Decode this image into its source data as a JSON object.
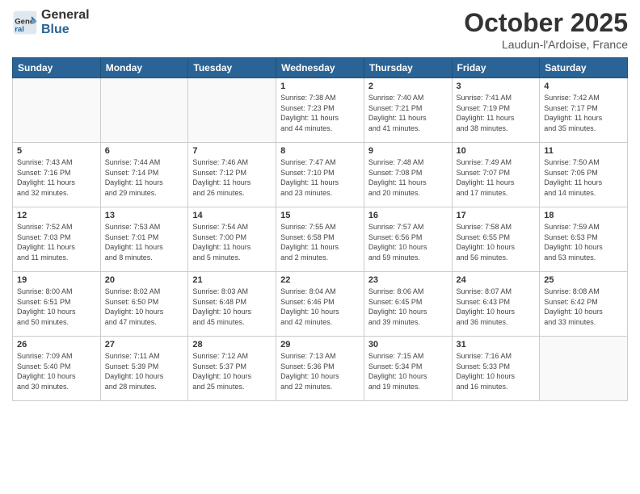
{
  "header": {
    "logo_general": "General",
    "logo_blue": "Blue",
    "month_title": "October 2025",
    "location": "Laudun-l'Ardoise, France"
  },
  "days_of_week": [
    "Sunday",
    "Monday",
    "Tuesday",
    "Wednesday",
    "Thursday",
    "Friday",
    "Saturday"
  ],
  "weeks": [
    [
      {
        "day": "",
        "info": ""
      },
      {
        "day": "",
        "info": ""
      },
      {
        "day": "",
        "info": ""
      },
      {
        "day": "1",
        "info": "Sunrise: 7:38 AM\nSunset: 7:23 PM\nDaylight: 11 hours\nand 44 minutes."
      },
      {
        "day": "2",
        "info": "Sunrise: 7:40 AM\nSunset: 7:21 PM\nDaylight: 11 hours\nand 41 minutes."
      },
      {
        "day": "3",
        "info": "Sunrise: 7:41 AM\nSunset: 7:19 PM\nDaylight: 11 hours\nand 38 minutes."
      },
      {
        "day": "4",
        "info": "Sunrise: 7:42 AM\nSunset: 7:17 PM\nDaylight: 11 hours\nand 35 minutes."
      }
    ],
    [
      {
        "day": "5",
        "info": "Sunrise: 7:43 AM\nSunset: 7:16 PM\nDaylight: 11 hours\nand 32 minutes."
      },
      {
        "day": "6",
        "info": "Sunrise: 7:44 AM\nSunset: 7:14 PM\nDaylight: 11 hours\nand 29 minutes."
      },
      {
        "day": "7",
        "info": "Sunrise: 7:46 AM\nSunset: 7:12 PM\nDaylight: 11 hours\nand 26 minutes."
      },
      {
        "day": "8",
        "info": "Sunrise: 7:47 AM\nSunset: 7:10 PM\nDaylight: 11 hours\nand 23 minutes."
      },
      {
        "day": "9",
        "info": "Sunrise: 7:48 AM\nSunset: 7:08 PM\nDaylight: 11 hours\nand 20 minutes."
      },
      {
        "day": "10",
        "info": "Sunrise: 7:49 AM\nSunset: 7:07 PM\nDaylight: 11 hours\nand 17 minutes."
      },
      {
        "day": "11",
        "info": "Sunrise: 7:50 AM\nSunset: 7:05 PM\nDaylight: 11 hours\nand 14 minutes."
      }
    ],
    [
      {
        "day": "12",
        "info": "Sunrise: 7:52 AM\nSunset: 7:03 PM\nDaylight: 11 hours\nand 11 minutes."
      },
      {
        "day": "13",
        "info": "Sunrise: 7:53 AM\nSunset: 7:01 PM\nDaylight: 11 hours\nand 8 minutes."
      },
      {
        "day": "14",
        "info": "Sunrise: 7:54 AM\nSunset: 7:00 PM\nDaylight: 11 hours\nand 5 minutes."
      },
      {
        "day": "15",
        "info": "Sunrise: 7:55 AM\nSunset: 6:58 PM\nDaylight: 11 hours\nand 2 minutes."
      },
      {
        "day": "16",
        "info": "Sunrise: 7:57 AM\nSunset: 6:56 PM\nDaylight: 10 hours\nand 59 minutes."
      },
      {
        "day": "17",
        "info": "Sunrise: 7:58 AM\nSunset: 6:55 PM\nDaylight: 10 hours\nand 56 minutes."
      },
      {
        "day": "18",
        "info": "Sunrise: 7:59 AM\nSunset: 6:53 PM\nDaylight: 10 hours\nand 53 minutes."
      }
    ],
    [
      {
        "day": "19",
        "info": "Sunrise: 8:00 AM\nSunset: 6:51 PM\nDaylight: 10 hours\nand 50 minutes."
      },
      {
        "day": "20",
        "info": "Sunrise: 8:02 AM\nSunset: 6:50 PM\nDaylight: 10 hours\nand 47 minutes."
      },
      {
        "day": "21",
        "info": "Sunrise: 8:03 AM\nSunset: 6:48 PM\nDaylight: 10 hours\nand 45 minutes."
      },
      {
        "day": "22",
        "info": "Sunrise: 8:04 AM\nSunset: 6:46 PM\nDaylight: 10 hours\nand 42 minutes."
      },
      {
        "day": "23",
        "info": "Sunrise: 8:06 AM\nSunset: 6:45 PM\nDaylight: 10 hours\nand 39 minutes."
      },
      {
        "day": "24",
        "info": "Sunrise: 8:07 AM\nSunset: 6:43 PM\nDaylight: 10 hours\nand 36 minutes."
      },
      {
        "day": "25",
        "info": "Sunrise: 8:08 AM\nSunset: 6:42 PM\nDaylight: 10 hours\nand 33 minutes."
      }
    ],
    [
      {
        "day": "26",
        "info": "Sunrise: 7:09 AM\nSunset: 5:40 PM\nDaylight: 10 hours\nand 30 minutes."
      },
      {
        "day": "27",
        "info": "Sunrise: 7:11 AM\nSunset: 5:39 PM\nDaylight: 10 hours\nand 28 minutes."
      },
      {
        "day": "28",
        "info": "Sunrise: 7:12 AM\nSunset: 5:37 PM\nDaylight: 10 hours\nand 25 minutes."
      },
      {
        "day": "29",
        "info": "Sunrise: 7:13 AM\nSunset: 5:36 PM\nDaylight: 10 hours\nand 22 minutes."
      },
      {
        "day": "30",
        "info": "Sunrise: 7:15 AM\nSunset: 5:34 PM\nDaylight: 10 hours\nand 19 minutes."
      },
      {
        "day": "31",
        "info": "Sunrise: 7:16 AM\nSunset: 5:33 PM\nDaylight: 10 hours\nand 16 minutes."
      },
      {
        "day": "",
        "info": ""
      }
    ]
  ]
}
